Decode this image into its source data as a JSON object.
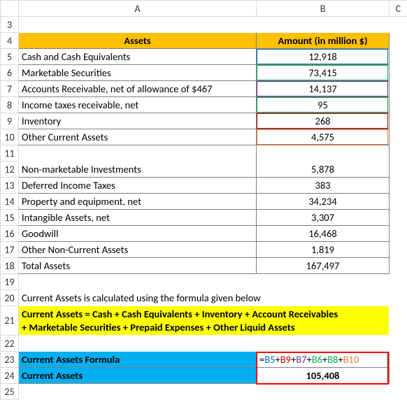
{
  "columns": {
    "A": "A",
    "B": "B",
    "C": "C"
  },
  "rows": {
    "r3": "3",
    "r4": "4",
    "r5": "5",
    "r6": "6",
    "r7": "7",
    "r8": "8",
    "r9": "9",
    "r10": "10",
    "r11": "11",
    "r12": "12",
    "r13": "13",
    "r14": "14",
    "r15": "15",
    "r16": "16",
    "r17": "17",
    "r18": "18",
    "r19": "19",
    "r20": "20",
    "r21": "21",
    "r22": "22",
    "r23": "23",
    "r24": "24",
    "r25": "25"
  },
  "headers": {
    "assets": "Assets",
    "amount": "Amount (in million $)"
  },
  "data": {
    "r5": {
      "label": "Cash and Cash Equivalents",
      "value": "12,918"
    },
    "r6": {
      "label": "Marketable Securities",
      "value": "73,415"
    },
    "r7": {
      "label": "Accounts Receivable, net of allowance of $467",
      "value": "14,137"
    },
    "r8": {
      "label": "Income taxes receivable, net",
      "value": "95"
    },
    "r9": {
      "label": "Inventory",
      "value": "268"
    },
    "r10": {
      "label": "Other Current Assets",
      "value": "4,575"
    },
    "r12": {
      "label": "Non-marketable Investments",
      "value": "5,878"
    },
    "r13": {
      "label": "Deferred Income Taxes",
      "value": "383"
    },
    "r14": {
      "label": "Property and equipment, net",
      "value": "34,234"
    },
    "r15": {
      "label": "Intangible Assets, net",
      "value": "3,307"
    },
    "r16": {
      "label": "Goodwill",
      "value": "16,468"
    },
    "r17": {
      "label": "Other Non-Current Assets",
      "value": "1,819"
    },
    "r18": {
      "label": "Total Assets",
      "value": "167,497"
    }
  },
  "note": "Current Assets is calculated using the formula given below",
  "desc1": "Current Assets = Cash + Cash Equivalents + Inventory + Account Receivables",
  "desc2": "+ Marketable Securities + Prepaid Expenses + Other Liquid Assets",
  "result": {
    "formula_label": "Current Assets Formula",
    "total_label": "Current Assets",
    "total_value": "105,408"
  },
  "formula": {
    "eq": "=",
    "b5": "B5",
    "b9": "B9",
    "b7": "B7",
    "b6": "B6",
    "b8": "B8",
    "b10": "B10",
    "plus": "+"
  },
  "chart_data": {
    "type": "table",
    "title": "Assets — Amount (in million $)",
    "rows": [
      {
        "label": "Cash and Cash Equivalents",
        "value": 12918
      },
      {
        "label": "Marketable Securities",
        "value": 73415
      },
      {
        "label": "Accounts Receivable, net of allowance of $467",
        "value": 14137
      },
      {
        "label": "Income taxes receivable, net",
        "value": 95
      },
      {
        "label": "Inventory",
        "value": 268
      },
      {
        "label": "Other Current Assets",
        "value": 4575
      },
      {
        "label": "Non-marketable Investments",
        "value": 5878
      },
      {
        "label": "Deferred Income Taxes",
        "value": 383
      },
      {
        "label": "Property and equipment, net",
        "value": 34234
      },
      {
        "label": "Intangible Assets, net",
        "value": 3307
      },
      {
        "label": "Goodwill",
        "value": 16468
      },
      {
        "label": "Other Non-Current Assets",
        "value": 1819
      },
      {
        "label": "Total Assets",
        "value": 167497
      }
    ],
    "computed": {
      "Current Assets": 105408,
      "formula": "=B5+B9+B7+B6+B8+B10"
    }
  }
}
